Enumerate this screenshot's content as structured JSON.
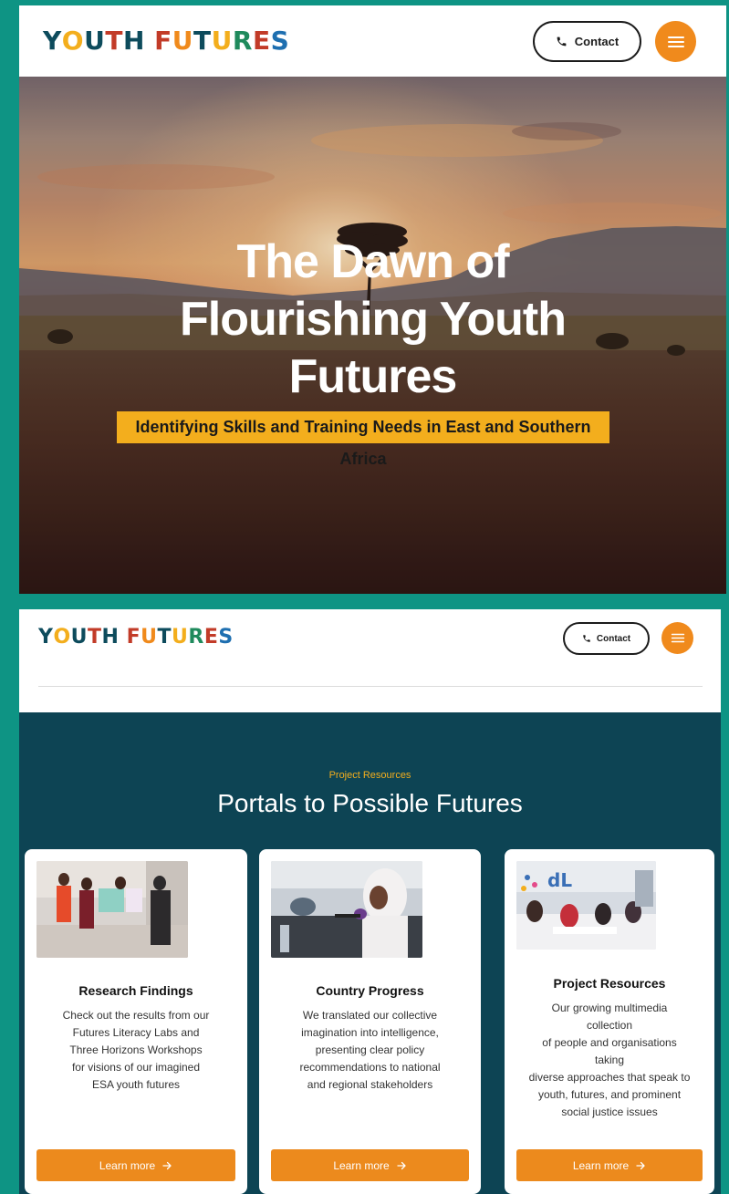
{
  "brand": {
    "logo_letters": [
      "Y",
      "O",
      "U",
      "T",
      "H",
      " ",
      "F",
      "U",
      "T",
      "U",
      "R",
      "E",
      "S"
    ],
    "logo_colors": [
      "#0d4b5c",
      "#f3ae1d",
      "#0d4b5c",
      "#c23b28",
      "#0d4b5c",
      "#ffffff",
      "#c23b28",
      "#f08a1c",
      "#0d4b5c",
      "#f3ae1d",
      "#1f8a5c",
      "#c23b28",
      "#1e6fb0"
    ]
  },
  "header": {
    "contact_label": "Contact",
    "phone_icon": "phone-icon",
    "menu_icon": "hamburger-menu-icon",
    "menu_color": "#f08a1c"
  },
  "hero": {
    "title_lines": [
      "The Dawn of",
      "Flourishing Youth",
      "Futures"
    ],
    "badge": "Identifying Skills and Training Needs in East and Southern Africa",
    "badge_color": "#f3ae1d"
  },
  "resources": {
    "eyebrow": "Project Resources",
    "title": "Portals to Possible Futures",
    "background": "#0d4454",
    "cards": [
      {
        "image": "girls-holding-posters-photo",
        "title": "Research Findings",
        "desc_lines": [
          "Check out the results from our",
          "Futures Literacy Labs and",
          "Three Horizons Workshops",
          "for visions of our imagined",
          "ESA youth futures"
        ],
        "button": "Learn more"
      },
      {
        "image": "girl-with-microphone-photo",
        "title": "Country Progress",
        "desc_lines": [
          "We translated our collective",
          "imagination into intelligence,",
          "presenting clear policy",
          "recommendations to national",
          "and regional stakeholders"
        ],
        "button": "Learn more"
      },
      {
        "image": "workshop-group-photo",
        "title": "Project Resources",
        "desc_lines": [
          "Our growing multimedia",
          "collection",
          "of people and organisations",
          "taking",
          "diverse approaches that speak to",
          "youth, futures, and prominent",
          "social justice issues"
        ],
        "button": "Learn more"
      }
    ]
  }
}
